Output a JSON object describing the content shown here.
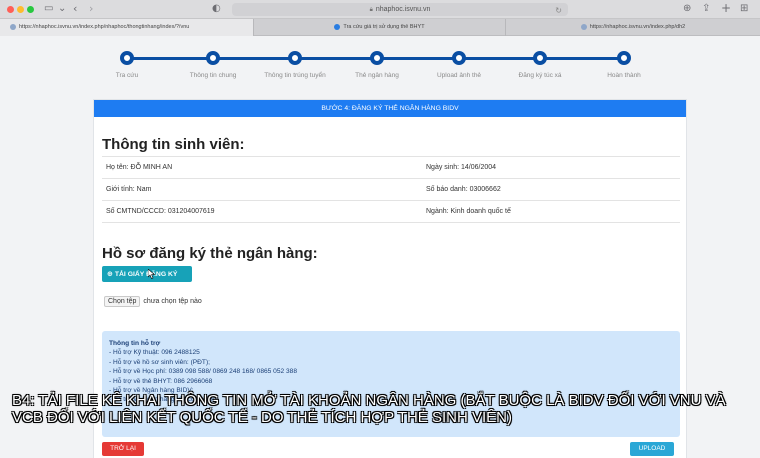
{
  "browser": {
    "address": "nhaphoc.isvnu.vn",
    "tabs": [
      {
        "label": "https://nhaphoc.isvnu.vn/index.php/nhaphoc/thongtinhang/index/?/vnu"
      },
      {
        "label": "Tra cứu giá trị sử dụng thẻ BHYT"
      },
      {
        "label": "https://nhaphoc.isvnu.vn/index.php/dh2"
      }
    ],
    "icons": [
      "sidebar-icon",
      "back-icon",
      "forward-icon",
      "shield-icon",
      "lock-icon",
      "reload-icon",
      "download-icon",
      "share-icon",
      "new-tab-icon",
      "tab-overview-icon"
    ]
  },
  "steps": [
    {
      "label": "Tra cứu"
    },
    {
      "label": "Thông tin chung"
    },
    {
      "label": "Thông tin trúng tuyển"
    },
    {
      "label": "Thẻ ngân hàng"
    },
    {
      "label": "Upload ảnh thẻ"
    },
    {
      "label": "Đăng ký túc xá"
    },
    {
      "label": "Hoàn thành"
    }
  ],
  "card": {
    "header": "BƯỚC 4: ĐĂNG KÝ THẺ NGÂN HÀNG BIDV",
    "student_title": "Thông tin sinh viên:",
    "rows": [
      {
        "left": "Họ tên: ĐỖ MINH AN",
        "right": "Ngày sinh: 14/06/2004"
      },
      {
        "left": "Giới tính: Nam",
        "right": "Số báo danh: 03006662"
      },
      {
        "left": "Số CMTND/CCCD: 031204007619",
        "right": "Ngành: Kinh doanh quốc tế"
      }
    ],
    "bank_title": "Hồ sơ đăng ký thẻ ngân hàng:",
    "download_label": "TẢI GIẤY ĐĂNG KÝ",
    "file_button": "Chọn tệp",
    "file_status": "chưa chọn tệp nào",
    "support": {
      "title": "Thông tin hỗ trợ",
      "lines": [
        "- Hỗ trợ Kỹ thuật: 096 2488125",
        "- Hỗ trợ về hồ sơ sinh viên: (PĐT);",
        "- Hỗ trợ về Học phí: 0389 098 588/ 0869 248 168/ 0865 052 388",
        "- Hỗ trợ về thẻ BHYT: 086 2966068",
        "- Hỗ trợ về Ngân hàng BIDV:",
        "- Hỗ trợ về Ngân hàng Vietcombank:"
      ]
    },
    "back_label": "TRỞ LẠI",
    "upload_label": "UPLOAD"
  },
  "caption": "B4: TẢI FILE KÊ KHAI THÔNG TIN MỞ TÀI KHOẢN NGÂN HÀNG (BẮT BUỘC LÀ BIDV ĐỐI VỚI VNU VÀ VCB ĐỐI VỚI LIÊN KẾT QUỐC TẾ - DO THẺ TÍCH HỢP THẺ SINH VIÊN)",
  "colors": {
    "primary": "#1e7cf2",
    "step": "#0a4ea3",
    "info": "#17a2b8",
    "danger": "#e53935",
    "support_bg": "#d1e6fb"
  }
}
